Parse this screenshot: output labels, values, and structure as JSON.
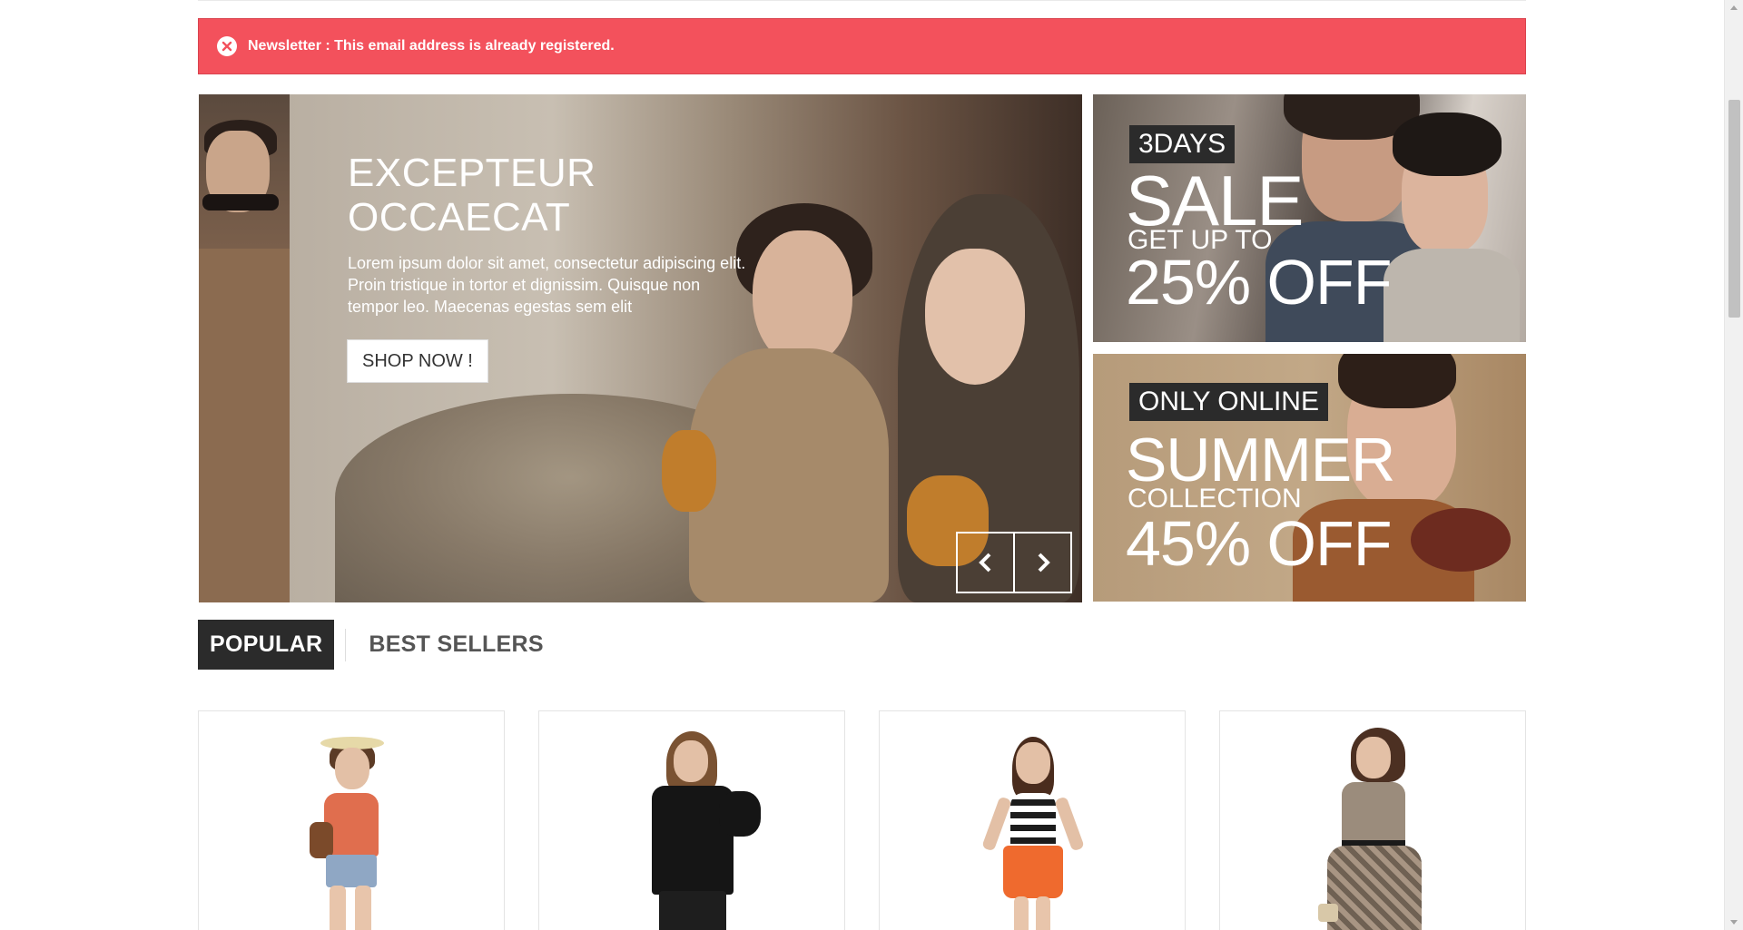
{
  "alert": {
    "message": "Newsletter : This email address is already registered.",
    "color": "#f3515c",
    "icon": "close-circle-icon"
  },
  "slider": {
    "title_line1": "EXCEPTEUR",
    "title_line2": "OCCAECAT",
    "text": "Lorem ipsum dolor sit amet, consectetur adipiscing elit. Proin tristique in tortor et dignissim. Quisque non tempor leo. Maecenas egestas sem elit",
    "button_label": "SHOP NOW !",
    "prev_icon": "chevron-left-icon",
    "next_icon": "chevron-right-icon"
  },
  "banners": [
    {
      "tag": "3DAYS",
      "big": "SALE",
      "mid": "GET UP TO",
      "big2": "25% OFF"
    },
    {
      "tag": "ONLY ONLINE",
      "big": "SUMMER",
      "mid": "COLLECTION",
      "big2": "45% OFF"
    }
  ],
  "tabs": [
    {
      "label": "POPULAR",
      "active": true
    },
    {
      "label": "BEST SELLERS",
      "active": false
    }
  ],
  "products": [
    {
      "name": "product-1"
    },
    {
      "name": "product-2"
    },
    {
      "name": "product-3"
    },
    {
      "name": "product-4"
    }
  ]
}
